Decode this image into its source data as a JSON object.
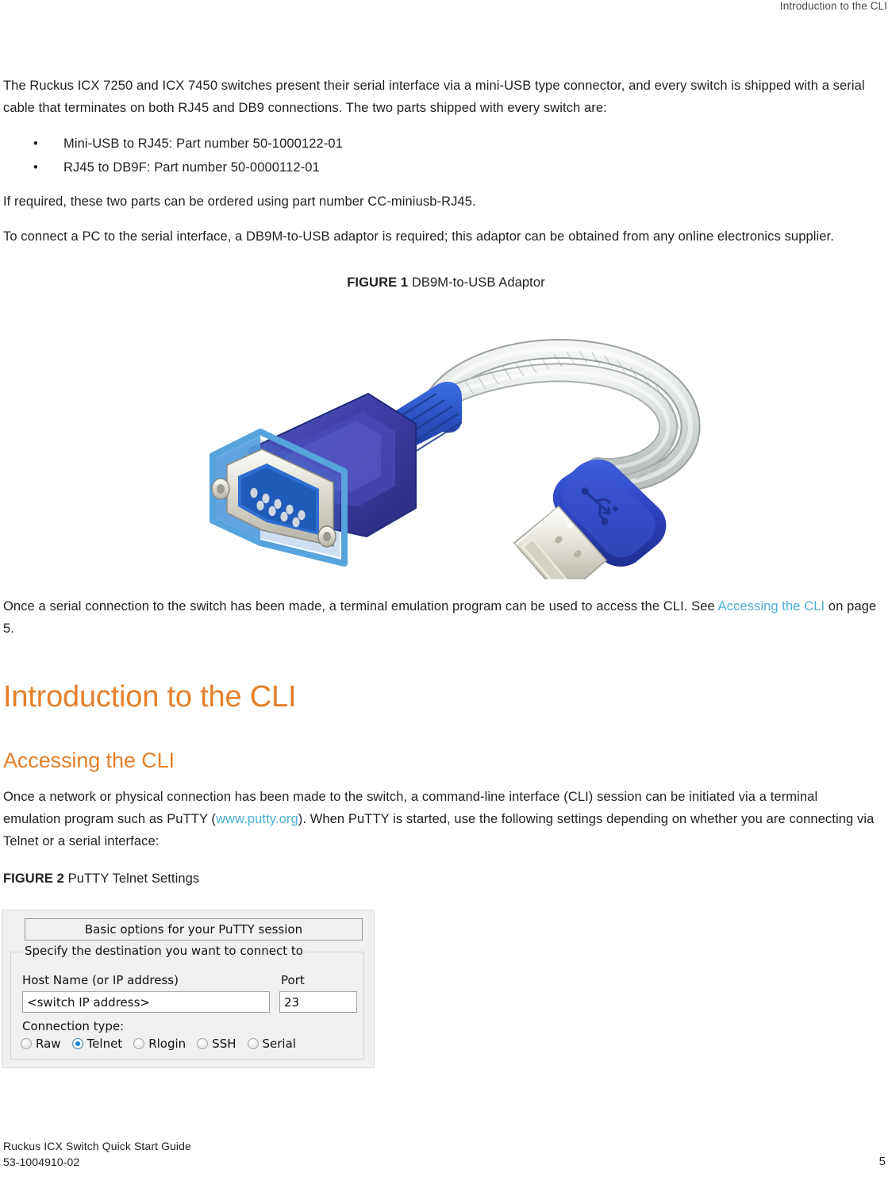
{
  "header": {
    "running_head": "Introduction to the CLI"
  },
  "body": {
    "intro_paragraph": "The Ruckus ICX 7250 and ICX 7450 switches present their serial interface via a mini-USB type connector, and every switch is shipped with a serial cable that terminates on both RJ45 and DB9 connections. The two parts shipped with every switch are:",
    "bullets": [
      "Mini-USB to RJ45: Part number 50-1000122-01",
      "RJ45 to DB9F: Part number 50-0000112-01"
    ],
    "bullet_marker": "•",
    "ordering_paragraph": "If required, these two parts can be ordered using part number CC-miniusb-RJ45.",
    "adaptor_paragraph": "To connect a PC to the serial interface, a DB9M-to-USB adaptor is required; this adaptor can be obtained from any online electronics supplier.",
    "after_figure_1": {
      "lead": "Once a serial connection to the switch has been made, a terminal emulation program can be used to access the CLI. See ",
      "link": "Accessing the CLI",
      "tail": " on page 5."
    }
  },
  "figures": {
    "figure_1": {
      "label": "FIGURE 1",
      "title": " DB9M-to-USB Adaptor",
      "image_alt": "db9m-to-usb-adaptor-photo"
    },
    "figure_2": {
      "label": "FIGURE 2",
      "title": " PuTTY Telnet Settings"
    }
  },
  "headings": {
    "h1": "Introduction to the CLI",
    "h2": "Accessing the CLI"
  },
  "accessing_cli": {
    "paragraph_part1": "Once a network or physical connection has been made to the switch, a command-line interface (CLI) session can be initiated via a terminal emulation program such as PuTTY (",
    "link": "www.putty.org",
    "paragraph_part2": "). When PuTTY is started, use the following settings depending on whether you are connecting via Telnet or a serial interface:"
  },
  "putty": {
    "title": "Basic options for your PuTTY session",
    "group_legend": "Specify the destination you want to connect to",
    "host_label": "Host Name (or IP address)",
    "host_value": "<switch IP address>",
    "port_label": "Port",
    "port_value": "23",
    "connection_type_label": "Connection type:",
    "connection_types": [
      {
        "label": "Raw",
        "selected": false
      },
      {
        "label": "Telnet",
        "selected": true
      },
      {
        "label": "Rlogin",
        "selected": false
      },
      {
        "label": "SSH",
        "selected": false
      },
      {
        "label": "Serial",
        "selected": false
      }
    ]
  },
  "footer": {
    "doc_title": "Ruckus ICX Switch Quick Start Guide",
    "doc_number": "53-1004910-02",
    "page_number": "5"
  },
  "colors": {
    "heading_orange": "#e4802a",
    "link_blue": "#4aafd5",
    "body_text": "#231f20"
  }
}
